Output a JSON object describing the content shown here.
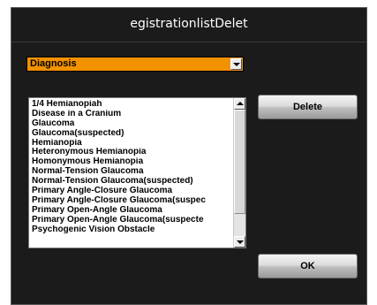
{
  "dialog": {
    "title": "egistrationlistDelet"
  },
  "dropdown": {
    "selected": "Diagnosis",
    "accent_color": "#f29200"
  },
  "list": {
    "items": [
      "1/4 Hemianopiah",
      "Disease in a Cranium",
      "Glaucoma",
      "Glaucoma(suspected)",
      "Hemianopia",
      "Heteronymous Hemianopia",
      "Homonymous Hemianopia",
      "Normal-Tension Glaucoma",
      "Normal-Tension Glaucoma(suspected)",
      "Primary Angle-Closure Glaucoma",
      "Primary Angle-Closure Glaucoma(suspec",
      "Primary Open-Angle Glaucoma",
      "Primary Open-Angle Glaucoma(suspecte",
      "Psychogenic Vision Obstacle"
    ]
  },
  "buttons": {
    "delete_label": "Delete",
    "ok_label": "OK"
  }
}
